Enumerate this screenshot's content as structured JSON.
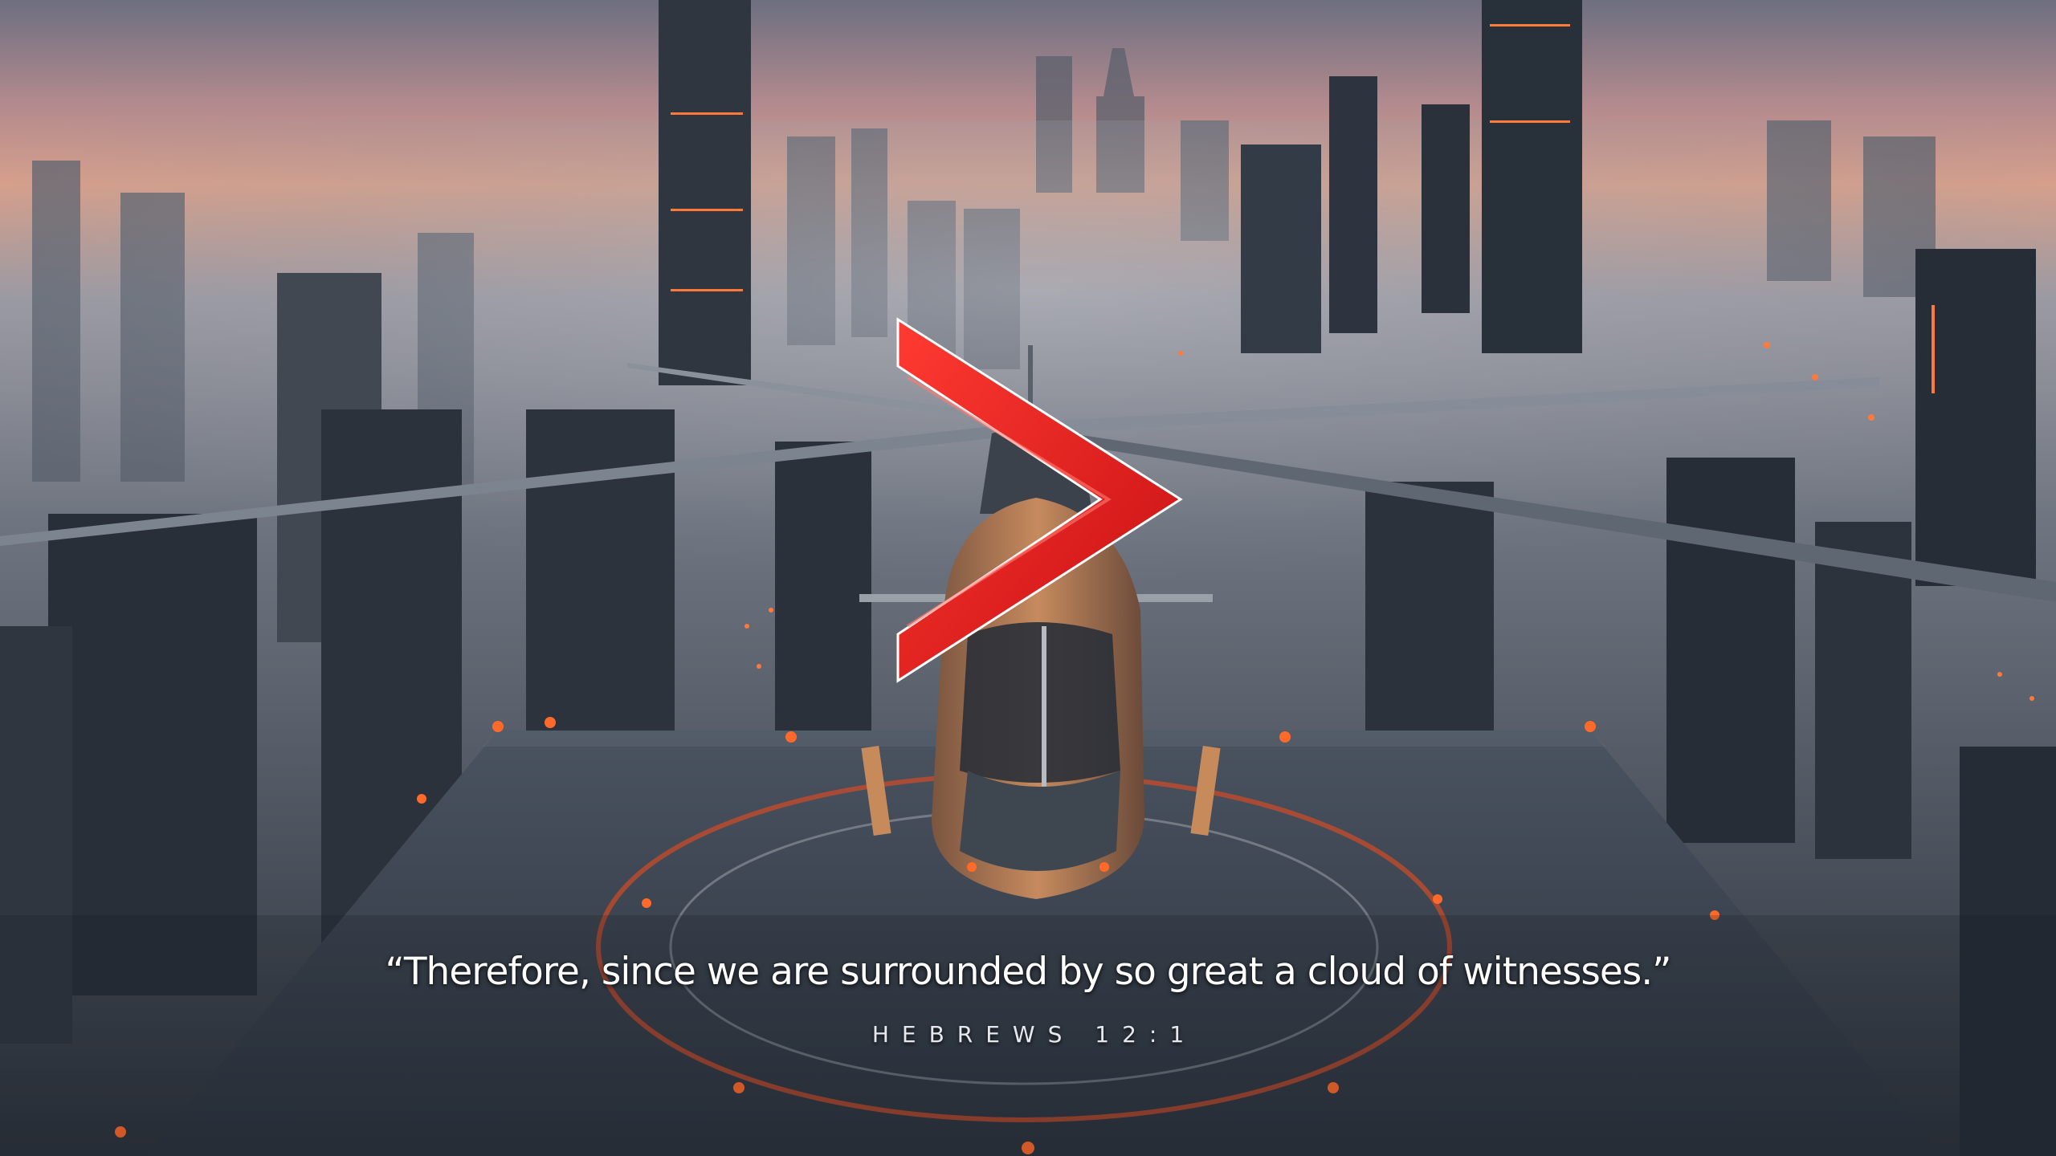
{
  "slide": {
    "quote": "“Therefore, since we are surrounded by so great a cloud of witnesses.”",
    "reference": "HEBREWS 12:1"
  },
  "background": {
    "description_icon": "city-helipad-helicopter-illustration",
    "sky_color_top": "#6d6f80",
    "sky_glow_color": "#e8a68a",
    "fog_color": "#8a919c",
    "building_color": "#2e3540",
    "helipad_color": "#3a4350",
    "light_color": "#ff6a2a"
  },
  "logo": {
    "icon": "chevron-right-icon",
    "color": "#e01d1d"
  }
}
